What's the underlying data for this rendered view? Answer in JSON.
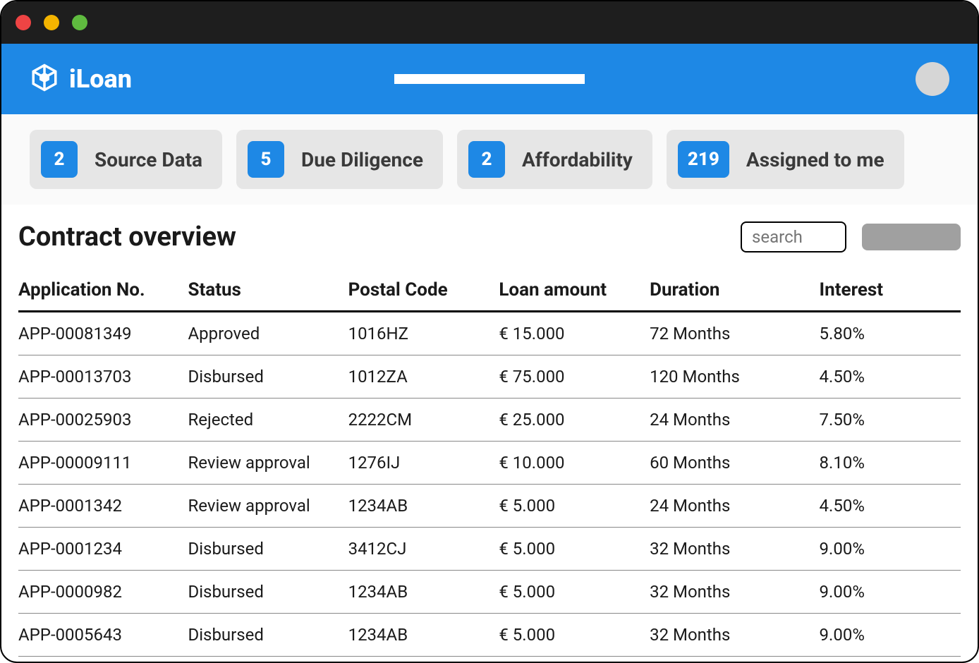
{
  "brand": {
    "name": "iLoan"
  },
  "pills": [
    {
      "count": "2",
      "label": "Source Data"
    },
    {
      "count": "5",
      "label": "Due Diligence"
    },
    {
      "count": "2",
      "label": "Affordability"
    },
    {
      "count": "219",
      "label": "Assigned to me"
    }
  ],
  "page": {
    "title": "Contract overview",
    "search_placeholder": "search"
  },
  "table": {
    "columns": {
      "app": "Application No.",
      "status": "Status",
      "postal": "Postal Code",
      "loan": "Loan amount",
      "duration": "Duration",
      "interest": "Interest"
    },
    "rows": [
      {
        "app": "APP-00081349",
        "status": "Approved",
        "postal": "1016HZ",
        "loan": "€ 15.000",
        "duration": "72 Months",
        "interest": "5.80%"
      },
      {
        "app": "APP-00013703",
        "status": "Disbursed",
        "postal": "1012ZA",
        "loan": "€ 75.000",
        "duration": "120 Months",
        "interest": "4.50%"
      },
      {
        "app": "APP-00025903",
        "status": "Rejected",
        "postal": "2222CM",
        "loan": "€ 25.000",
        "duration": "24 Months",
        "interest": "7.50%"
      },
      {
        "app": "APP-00009111",
        "status": "Review approval",
        "postal": "1276IJ",
        "loan": "€ 10.000",
        "duration": "60 Months",
        "interest": "8.10%"
      },
      {
        "app": "APP-0001342",
        "status": "Review approval",
        "postal": "1234AB",
        "loan": "€ 5.000",
        "duration": "24 Months",
        "interest": "4.50%"
      },
      {
        "app": "APP-0001234",
        "status": "Disbursed",
        "postal": "3412CJ",
        "loan": "€ 5.000",
        "duration": "32 Months",
        "interest": "9.00%"
      },
      {
        "app": "APP-0000982",
        "status": "Disbursed",
        "postal": "1234AB",
        "loan": "€ 5.000",
        "duration": "32 Months",
        "interest": "9.00%"
      },
      {
        "app": "APP-0005643",
        "status": "Disbursed",
        "postal": "1234AB",
        "loan": "€ 5.000",
        "duration": "32 Months",
        "interest": "9.00%"
      }
    ]
  }
}
